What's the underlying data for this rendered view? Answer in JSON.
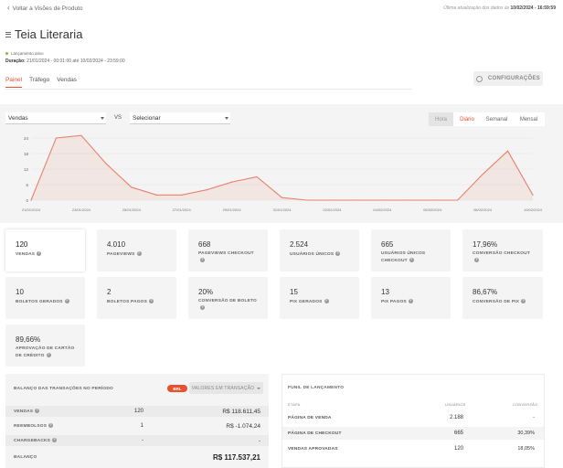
{
  "topbar": {
    "back_label": "Voltar a Visões de Produto",
    "update_prefix": "Última atualização dos dados às",
    "update_value": "10/02/2024 - 16:59:59"
  },
  "page": {
    "title": "Teia Literaria",
    "status_text": "Lançamento ativo",
    "duration_label": "Duração:",
    "duration_value": "21/01/2024 - 00:01:00 até 10/02/2024 - 23:59:00",
    "config_label": "CONFIGURAÇÕES"
  },
  "tabs": [
    {
      "label": "Painel",
      "active": true
    },
    {
      "label": "Tráfego",
      "active": false
    },
    {
      "label": "Vendas",
      "active": false
    }
  ],
  "chart_controls": {
    "primary_select": "Vendas",
    "vs_label": "VS",
    "compare_select": "Selecionar",
    "periods": [
      "Hora",
      "Diário",
      "Semanal",
      "Mensal"
    ],
    "active_period": "Diário"
  },
  "chart_data": {
    "type": "area",
    "color": "#e8826e",
    "y_ticks": [
      "0",
      "6",
      "12",
      "18",
      "24"
    ],
    "ylim": [
      0,
      24
    ],
    "x_tick_labels": [
      "21/01/2024",
      "23/01/2024",
      "25/01/2024",
      "27/01/2024",
      "29/01/2024",
      "31/01/2024",
      "02/02/2024",
      "04/02/2024",
      "06/02/2024",
      "08/02/2024",
      "10/02/2024"
    ],
    "x": [
      "21/01/2024",
      "22/01/2024",
      "23/01/2024",
      "24/01/2024",
      "25/01/2024",
      "26/01/2024",
      "27/01/2024",
      "28/01/2024",
      "29/01/2024",
      "30/01/2024",
      "31/01/2024",
      "01/02/2024",
      "02/02/2024",
      "03/02/2024",
      "04/02/2024",
      "05/02/2024",
      "06/02/2024",
      "07/02/2024",
      "08/02/2024",
      "09/02/2024",
      "10/02/2024"
    ],
    "values": [
      0,
      24,
      25,
      14,
      5,
      2,
      2,
      4,
      7,
      9,
      1,
      0,
      0,
      0,
      0,
      0,
      0,
      0,
      10,
      19,
      2
    ]
  },
  "metrics": [
    {
      "value": "120",
      "label": "VENDAS",
      "help": true
    },
    {
      "value": "4.010",
      "label": "PAGEVIEWS",
      "help": true
    },
    {
      "value": "668",
      "label": "PAGEVIEWS CHECKOUT",
      "help": true
    },
    {
      "value": "2.524",
      "label": "USUÁRIOS ÚNICOS",
      "help": true
    },
    {
      "value": "665",
      "label": "USUÁRIOS ÚNICOS CHECKOUT",
      "help": true
    },
    {
      "value": "17,96%",
      "label": "CONVERSÃO CHECKOUT",
      "help": true
    },
    {
      "value": "10",
      "label": "BOLETOS GERADOS",
      "help": true
    },
    {
      "value": "2",
      "label": "BOLETOS PAGOS",
      "help": true
    },
    {
      "value": "20%",
      "label": "CONVERSÃO DE BOLETO",
      "help": true
    },
    {
      "value": "15",
      "label": "PIX GERADOS",
      "help": true
    },
    {
      "value": "13",
      "label": "PIX PAGOS",
      "help": true
    },
    {
      "value": "86,67%",
      "label": "CONVERSÃO DE PIX",
      "help": true
    },
    {
      "value": "89,66%",
      "label": "APROVAÇÃO DE CARTÃO DE CRÉDITO",
      "help": true
    }
  ],
  "balance": {
    "title": "BALANÇO DAS TRANSAÇÕES NO PERÍODO",
    "currency_badge": "BRL",
    "values_select": "VALORES EM TRANSAÇÃO",
    "rows": [
      {
        "label": "VENDAS",
        "qty": "120",
        "value": "R$ 118.611,45"
      },
      {
        "label": "REEMBOLSOS",
        "qty": "1",
        "value": "R$ -1.074,24"
      },
      {
        "label": "CHARGEBACKS",
        "qty": "-",
        "value": "-"
      },
      {
        "label": "BALANÇO",
        "qty": "",
        "value": "R$ 117.537,21"
      }
    ]
  },
  "funnel": {
    "title": "FUNIL DE LANÇAMENTO",
    "headers": [
      "ETAPA",
      "USUÁRIOS",
      "CONVERSÃO"
    ],
    "rows": [
      {
        "stage": "PÁGINA DE VENDA",
        "users": "2.188",
        "conversion": "-"
      },
      {
        "stage": "PÁGINA DE CHECKOUT",
        "users": "665",
        "conversion": "30,39%"
      },
      {
        "stage": "VENDAS APROVADAS",
        "users": "120",
        "conversion": "18,05%"
      }
    ]
  }
}
